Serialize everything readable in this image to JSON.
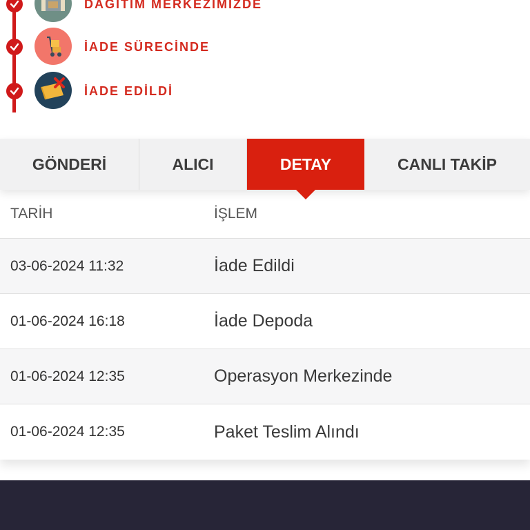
{
  "timeline": {
    "steps": [
      {
        "label": "DAĞITIM MERKEZİMİZDE",
        "icon": "warehouse-icon"
      },
      {
        "label": "İADE SÜRECİNDE",
        "icon": "hand-truck-icon"
      },
      {
        "label": "İADE EDİLDİ",
        "icon": "returned-package-icon"
      }
    ],
    "line_color": "#d0191a",
    "label_color": "#d42a1f"
  },
  "tabs": [
    {
      "label": "GÖNDERİ",
      "active": false
    },
    {
      "label": "ALICI",
      "active": false
    },
    {
      "label": "DETAY",
      "active": true
    },
    {
      "label": "CANLI TAKİP",
      "active": false
    }
  ],
  "table": {
    "headers": {
      "date": "TARİH",
      "operation": "İŞLEM"
    },
    "rows": [
      {
        "date": "03-06-2024 11:32",
        "operation": "İade Edildi"
      },
      {
        "date": "01-06-2024 16:18",
        "operation": "İade Depoda"
      },
      {
        "date": "01-06-2024 12:35",
        "operation": "Operasyon Merkezinde"
      },
      {
        "date": "01-06-2024 12:35",
        "operation": "Paket Teslim Alındı"
      }
    ]
  },
  "colors": {
    "accent": "#d9200f",
    "footer": "#272537"
  }
}
